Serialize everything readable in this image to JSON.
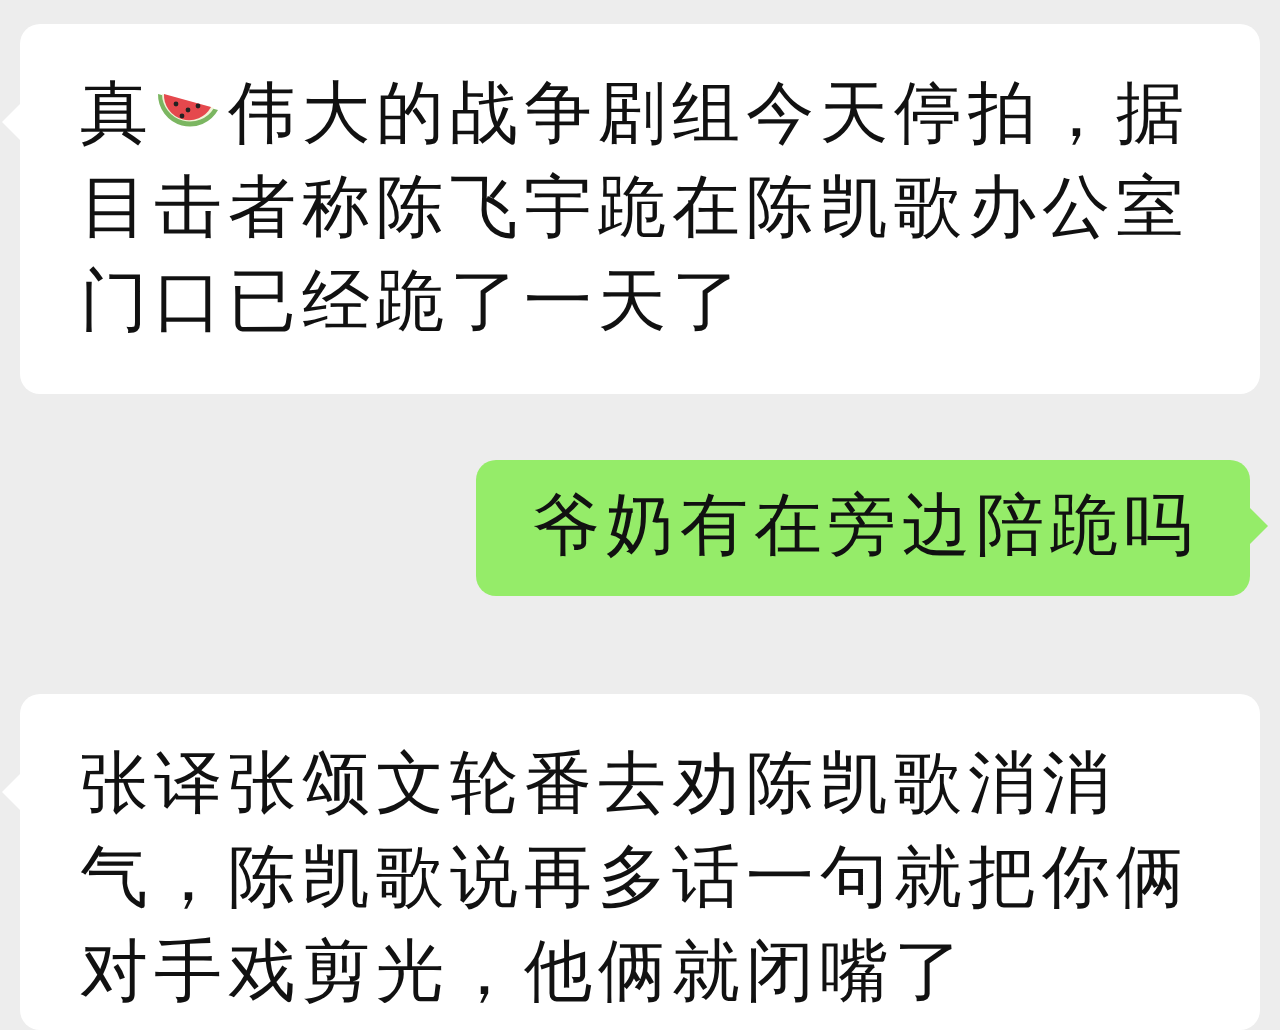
{
  "messages": [
    {
      "kind": "received",
      "parts": [
        {
          "kind": "text",
          "text": "真"
        },
        {
          "kind": "watermelon"
        },
        {
          "kind": "text",
          "text": "伟大的战争剧组今天停拍，据"
        },
        {
          "kind": "paragraph",
          "text": "目击者称陈飞宇跪在陈凯歌办公室门口已经跪了一天了"
        }
      ]
    },
    {
      "kind": "sent",
      "parts": [
        {
          "kind": "paragraph",
          "text": "爷奶有在旁边陪跪吗"
        }
      ]
    },
    {
      "kind": "received",
      "parts": [
        {
          "kind": "paragraph",
          "text": "张译张颂文轮番去劝陈凯歌消消气，陈凯歌说再多话一句就把你俩对手戏剪光，他俩就闭嘴了"
        }
      ]
    }
  ]
}
